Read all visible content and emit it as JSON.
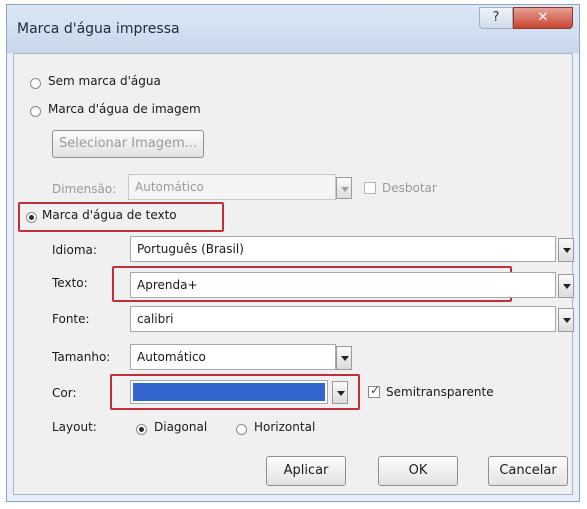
{
  "window": {
    "title": "Marca d'água impressa",
    "help_glyph": "?",
    "close_glyph": "✕"
  },
  "options": {
    "no_watermark": "Sem marca d'água",
    "image_watermark": "Marca d'água de imagem",
    "text_watermark": "Marca d'água de texto"
  },
  "image": {
    "select_button": "Selecionar Imagem...",
    "scale_label": "Dimensão:",
    "scale_value": "Automático",
    "washout_label": "Desbotar"
  },
  "text": {
    "language_label": "Idioma:",
    "language_value": "Português (Brasil)",
    "text_label": "Texto:",
    "text_value": "Aprenda+",
    "font_label": "Fonte:",
    "font_value": "calibri",
    "size_label": "Tamanho:",
    "size_value": "Automático",
    "color_label": "Cor:",
    "color_value": "#3366cc",
    "semitransparent_label": "Semitransparente",
    "layout_label": "Layout:",
    "layout_diagonal": "Diagonal",
    "layout_horizontal": "Horizontal"
  },
  "buttons": {
    "apply": "Aplicar",
    "ok": "OK",
    "cancel": "Cancelar"
  },
  "colors": {
    "highlight": "#c0303a"
  }
}
